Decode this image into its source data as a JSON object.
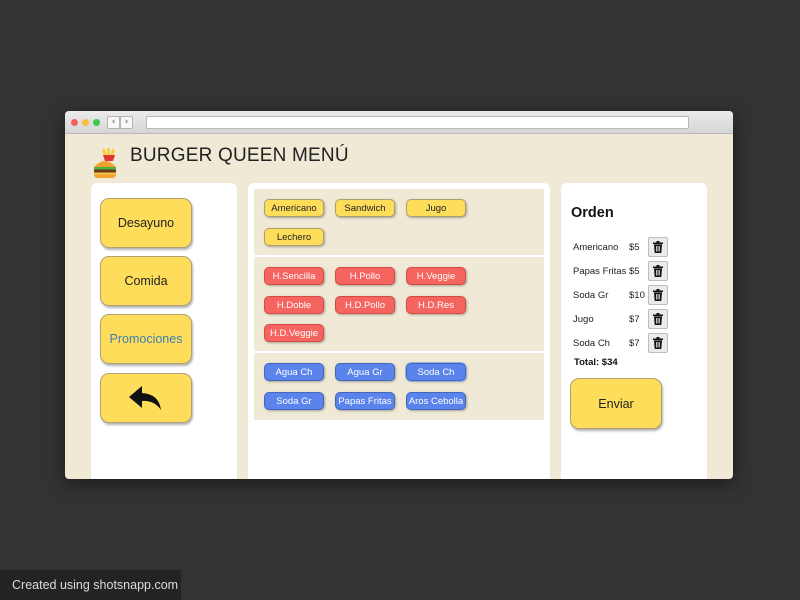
{
  "app": {
    "title": "BURGER QUEEN MENÚ",
    "logo_icon": "burger-fries-icon"
  },
  "categories": [
    {
      "label": "Desayuno",
      "icon": ""
    },
    {
      "label": "Comida",
      "icon": ""
    },
    {
      "label": "Promociones",
      "active": true,
      "color": "#3e7fb4"
    },
    {
      "label": "",
      "icon": "back-arrow-icon"
    }
  ],
  "menu": {
    "breakfast": [
      "Americano",
      "Sandwich",
      "Jugo",
      "Lechero"
    ],
    "burgers": [
      "H.Sencilla",
      "H.Pollo",
      "H.Veggie",
      "H.Doble",
      "H.D.Pollo",
      "H.D.Res",
      "H.D.Veggie"
    ],
    "drinks_sides": [
      "Agua Ch",
      "Agua Gr",
      "Soda Ch",
      "Soda Gr",
      "Papas Fritas",
      "Aros Cebolla"
    ]
  },
  "order": {
    "title": "Orden",
    "items": [
      {
        "name": "Americano",
        "price": "$5"
      },
      {
        "name": "Papas Fritas",
        "price": "$5"
      },
      {
        "name": "Soda Gr",
        "price": "$10"
      },
      {
        "name": "Jugo",
        "price": "$7"
      },
      {
        "name": "Soda Ch",
        "price": "$7"
      }
    ],
    "total": "Total: $34",
    "send_label": "Enviar",
    "delete_icon": "trash-icon"
  },
  "colors": {
    "accent_yellow": "#fedd5b",
    "burger_red": "#f5645f",
    "drink_blue": "#5a83ec",
    "background": "#efe9d6"
  },
  "footer": {
    "text": "Created using shotsnapp.com"
  }
}
